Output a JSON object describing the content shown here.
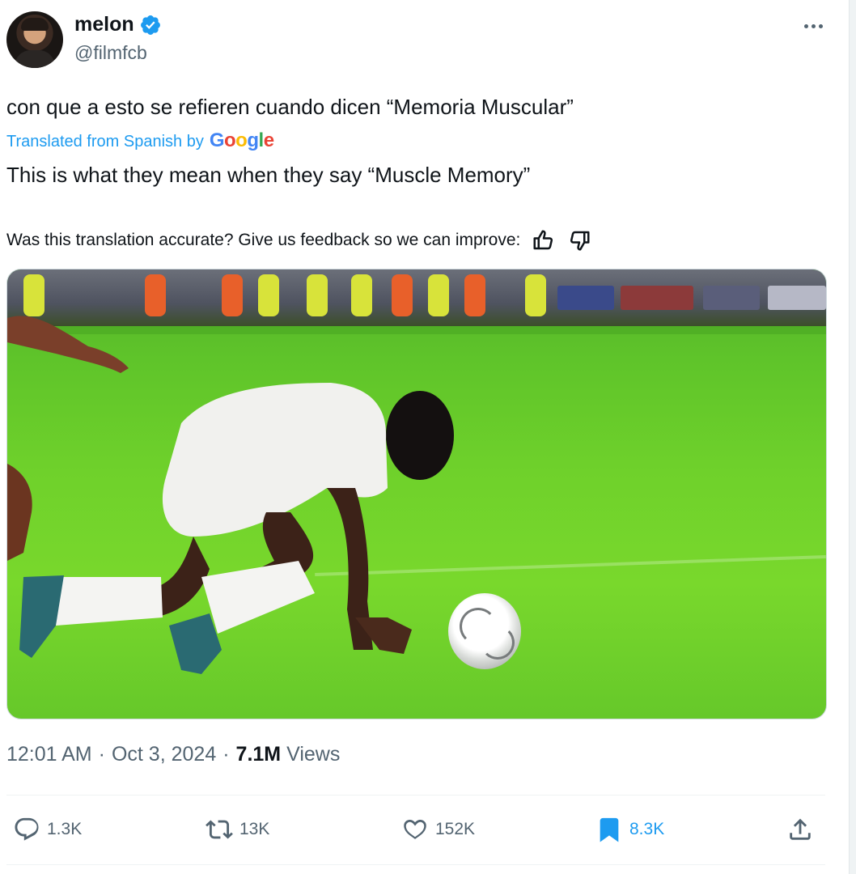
{
  "author": {
    "name": "melon",
    "handle": "@filmfcb"
  },
  "tweet": {
    "original_text": "con que a esto se refieren cuando dicen “Memoria Muscular”",
    "translation_label": "Translated from Spanish by",
    "translation_provider": "Google",
    "translated_text": "This is what they mean when they say “Muscle Memory”",
    "feedback_prompt": "Was this translation accurate? Give us feedback so we can improve:"
  },
  "meta": {
    "time": "12:01 AM",
    "date": "Oct 3, 2024",
    "views_count": "7.1M",
    "views_label": "Views"
  },
  "actions": {
    "replies": "1.3K",
    "reposts": "13K",
    "likes": "152K",
    "bookmarks": "8.3K"
  },
  "colors": {
    "accent": "#1d9bf0",
    "secondary_text": "#536471",
    "pitch_green": "#6fd12b"
  },
  "icons": [
    "verified-icon",
    "more-icon",
    "thumbs-up-icon",
    "thumbs-down-icon",
    "reply-icon",
    "repost-icon",
    "like-icon",
    "bookmark-icon",
    "share-icon"
  ]
}
